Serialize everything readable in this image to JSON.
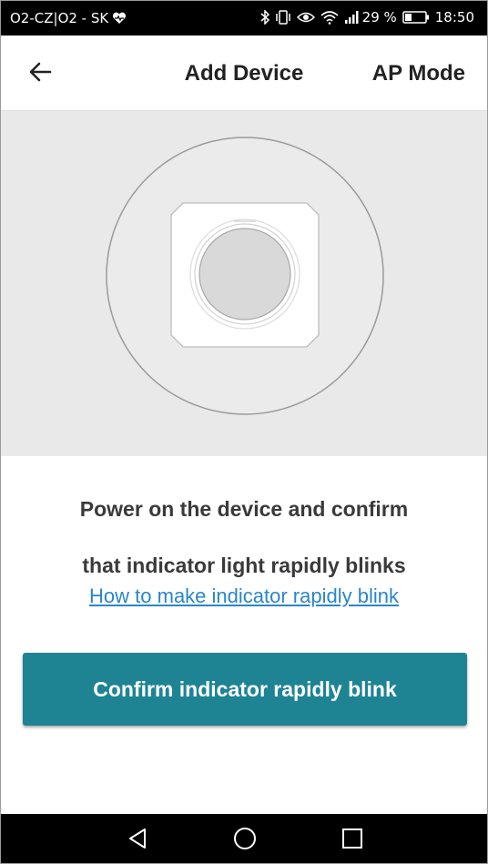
{
  "status_bar": {
    "carrier": "O2-CZ|O2 - SK",
    "battery": "29 %",
    "time": "18:50",
    "icons": [
      "heart-icon",
      "bluetooth-icon",
      "vibrate-icon",
      "eye-icon",
      "wifi-icon",
      "signal-icon",
      "battery-icon"
    ]
  },
  "app_bar": {
    "title": "Add Device",
    "action": "AP Mode",
    "back_icon": "arrow-left-icon"
  },
  "illustration": {
    "icon": "smart-plug-device-icon"
  },
  "instructions": {
    "line1": "Power on the device and confirm",
    "line2": "that indicator light rapidly blinks",
    "help_link": "How to make indicator rapidly blink"
  },
  "confirm_button": {
    "label": "Confirm indicator rapidly blink",
    "color": "#1e8494"
  },
  "nav_bar": {
    "icons": [
      "nav-back-icon",
      "nav-home-icon",
      "nav-recents-icon"
    ]
  }
}
